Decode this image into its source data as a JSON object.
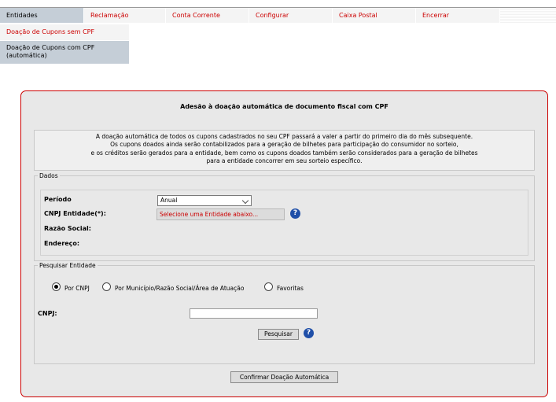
{
  "menu": {
    "tabs": [
      {
        "label": "Entidades"
      },
      {
        "label": "Reclamação"
      },
      {
        "label": "Conta Corrente"
      },
      {
        "label": "Configurar"
      },
      {
        "label": "Caixa Postal"
      },
      {
        "label": "Encerrar"
      }
    ]
  },
  "submenu": {
    "items": [
      {
        "label": "Doação de Cupons sem CPF"
      },
      {
        "label_line1": "Doação de Cupons com CPF",
        "label_line2": "(automática)"
      }
    ]
  },
  "panel": {
    "title": "Adesão à doação automática de documento fiscal com CPF",
    "info_lines": [
      "A doação automática de todos os cupons cadastrados no seu CPF passará a valer a partir do primeiro dia do mês subsequente.",
      "Os cupons doados ainda serão contabilizados para a geração de bilhetes para participação do consumidor no sorteio,",
      "e os créditos serão gerados para a entidade, bem como os cupons doados também serão considerados para a geração de bilhetes",
      "para a entidade concorrer em seu sorteio específico."
    ]
  },
  "dados": {
    "legend": "Dados",
    "periodo_label": "Período",
    "periodo_value": "Anual",
    "cnpj_entidade_label": "CNPJ Entidade(*):",
    "entidade_placeholder": "Selecione uma Entidade abaixo...",
    "razao_social_label": "Razão Social:",
    "endereco_label": "Endereço:",
    "help_symbol": "?"
  },
  "pesquisar": {
    "legend": "Pesquisar Entidade",
    "options": [
      {
        "label": "Por CNPJ",
        "selected": true
      },
      {
        "label": "Por Município/Razão Social/Área de Atuação",
        "selected": false
      },
      {
        "label": "Favoritas",
        "selected": false
      }
    ],
    "cnpj_label": "CNPJ:",
    "cnpj_value": "",
    "search_button": "Pesquisar",
    "help_symbol": "?"
  },
  "confirm_button": "Confirmar Doação Automática",
  "colors": {
    "accent_red": "#cc0000",
    "active_tab": "#c5ced7",
    "help_blue": "#1f4fa8"
  }
}
